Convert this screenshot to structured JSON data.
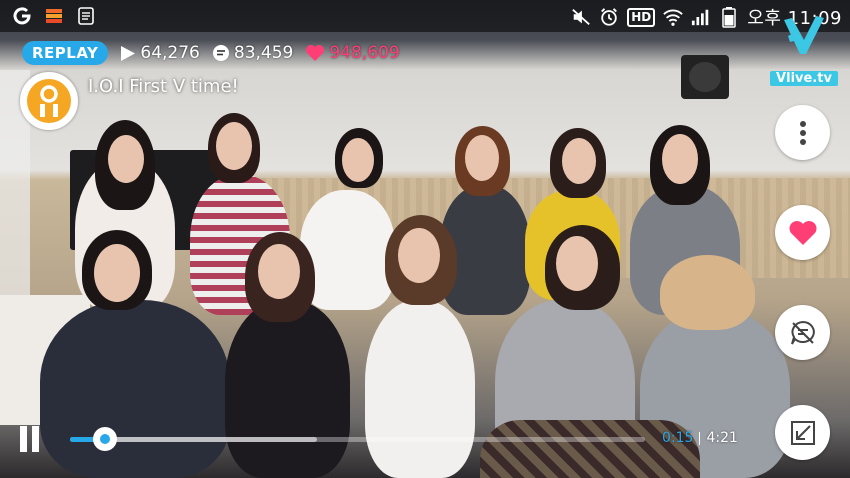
{
  "status_bar": {
    "app_icons": [
      "g-app-icon",
      "stack-app-icon",
      "notes-app-icon"
    ],
    "hd_label": "HD",
    "clock": "오후 11:09"
  },
  "broadcast": {
    "replay_label": "REPLAY",
    "plays": "64,276",
    "comments": "83,459",
    "likes": "948,609",
    "title": "I.O.I First V time!",
    "accent_color": "#27a8e8",
    "like_color": "#ff3e76"
  },
  "logo": {
    "text": "Vlive.tv"
  },
  "side_actions": [
    "more-options",
    "like",
    "comments-off",
    "minimize"
  ],
  "player": {
    "current_time": "0:15",
    "duration": "4:21",
    "progress": 0.06,
    "buffered": 0.43
  }
}
